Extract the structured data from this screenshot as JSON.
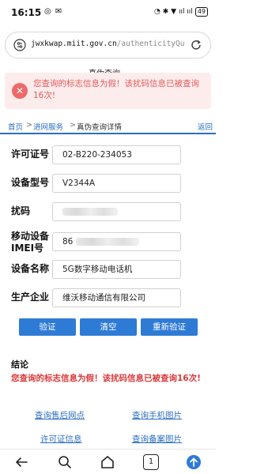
{
  "status_bar": {
    "time": "16:15",
    "indicators": "◎ ✉",
    "right_icons": "◔ ✱ ▼ ııl ııl",
    "battery": "49"
  },
  "browser": {
    "url_host": "jwxkwap.miit.gov.cn",
    "url_path": "/authenticityQueryDet"
  },
  "page": {
    "header_title": "真伪查询"
  },
  "toast": {
    "message": "您查询的标志信息为假！该扰码信息已被查询16次!"
  },
  "breadcrumb": {
    "home": "首页",
    "separator": ">",
    "service": "进网服务",
    "current": "真伪查询详情",
    "back": "返回"
  },
  "form": {
    "license_label": "许可证号",
    "license_value": "02-B220-234053",
    "model_label": "设备型号",
    "model_value": "V2344A",
    "scramble_label": "扰码",
    "imei_label_1": "移动设备",
    "imei_label_2": "IMEI号",
    "imei_value_prefix": "86",
    "device_label": "设备名称",
    "device_value": "5G数字移动电话机",
    "maker_label": "生产企业",
    "maker_value": "维沃移动通信有限公司"
  },
  "buttons": {
    "verify": "验证",
    "clear": "清空",
    "reverify": "重新验证"
  },
  "conclusion": {
    "title": "结论",
    "text": "您查询的标志信息为假！该扰码信息已被查询16次!"
  },
  "links": {
    "service_outlets": "查询售后网点",
    "phone_images": "查询手机图片",
    "license_info": "许可证信息",
    "filing_images": "查询备案图片"
  },
  "nav": {
    "tab_count": "1"
  },
  "colors": {
    "accent": "#2e7bd6",
    "error": "#d93a3a",
    "toast_bg": "#fdecec"
  }
}
